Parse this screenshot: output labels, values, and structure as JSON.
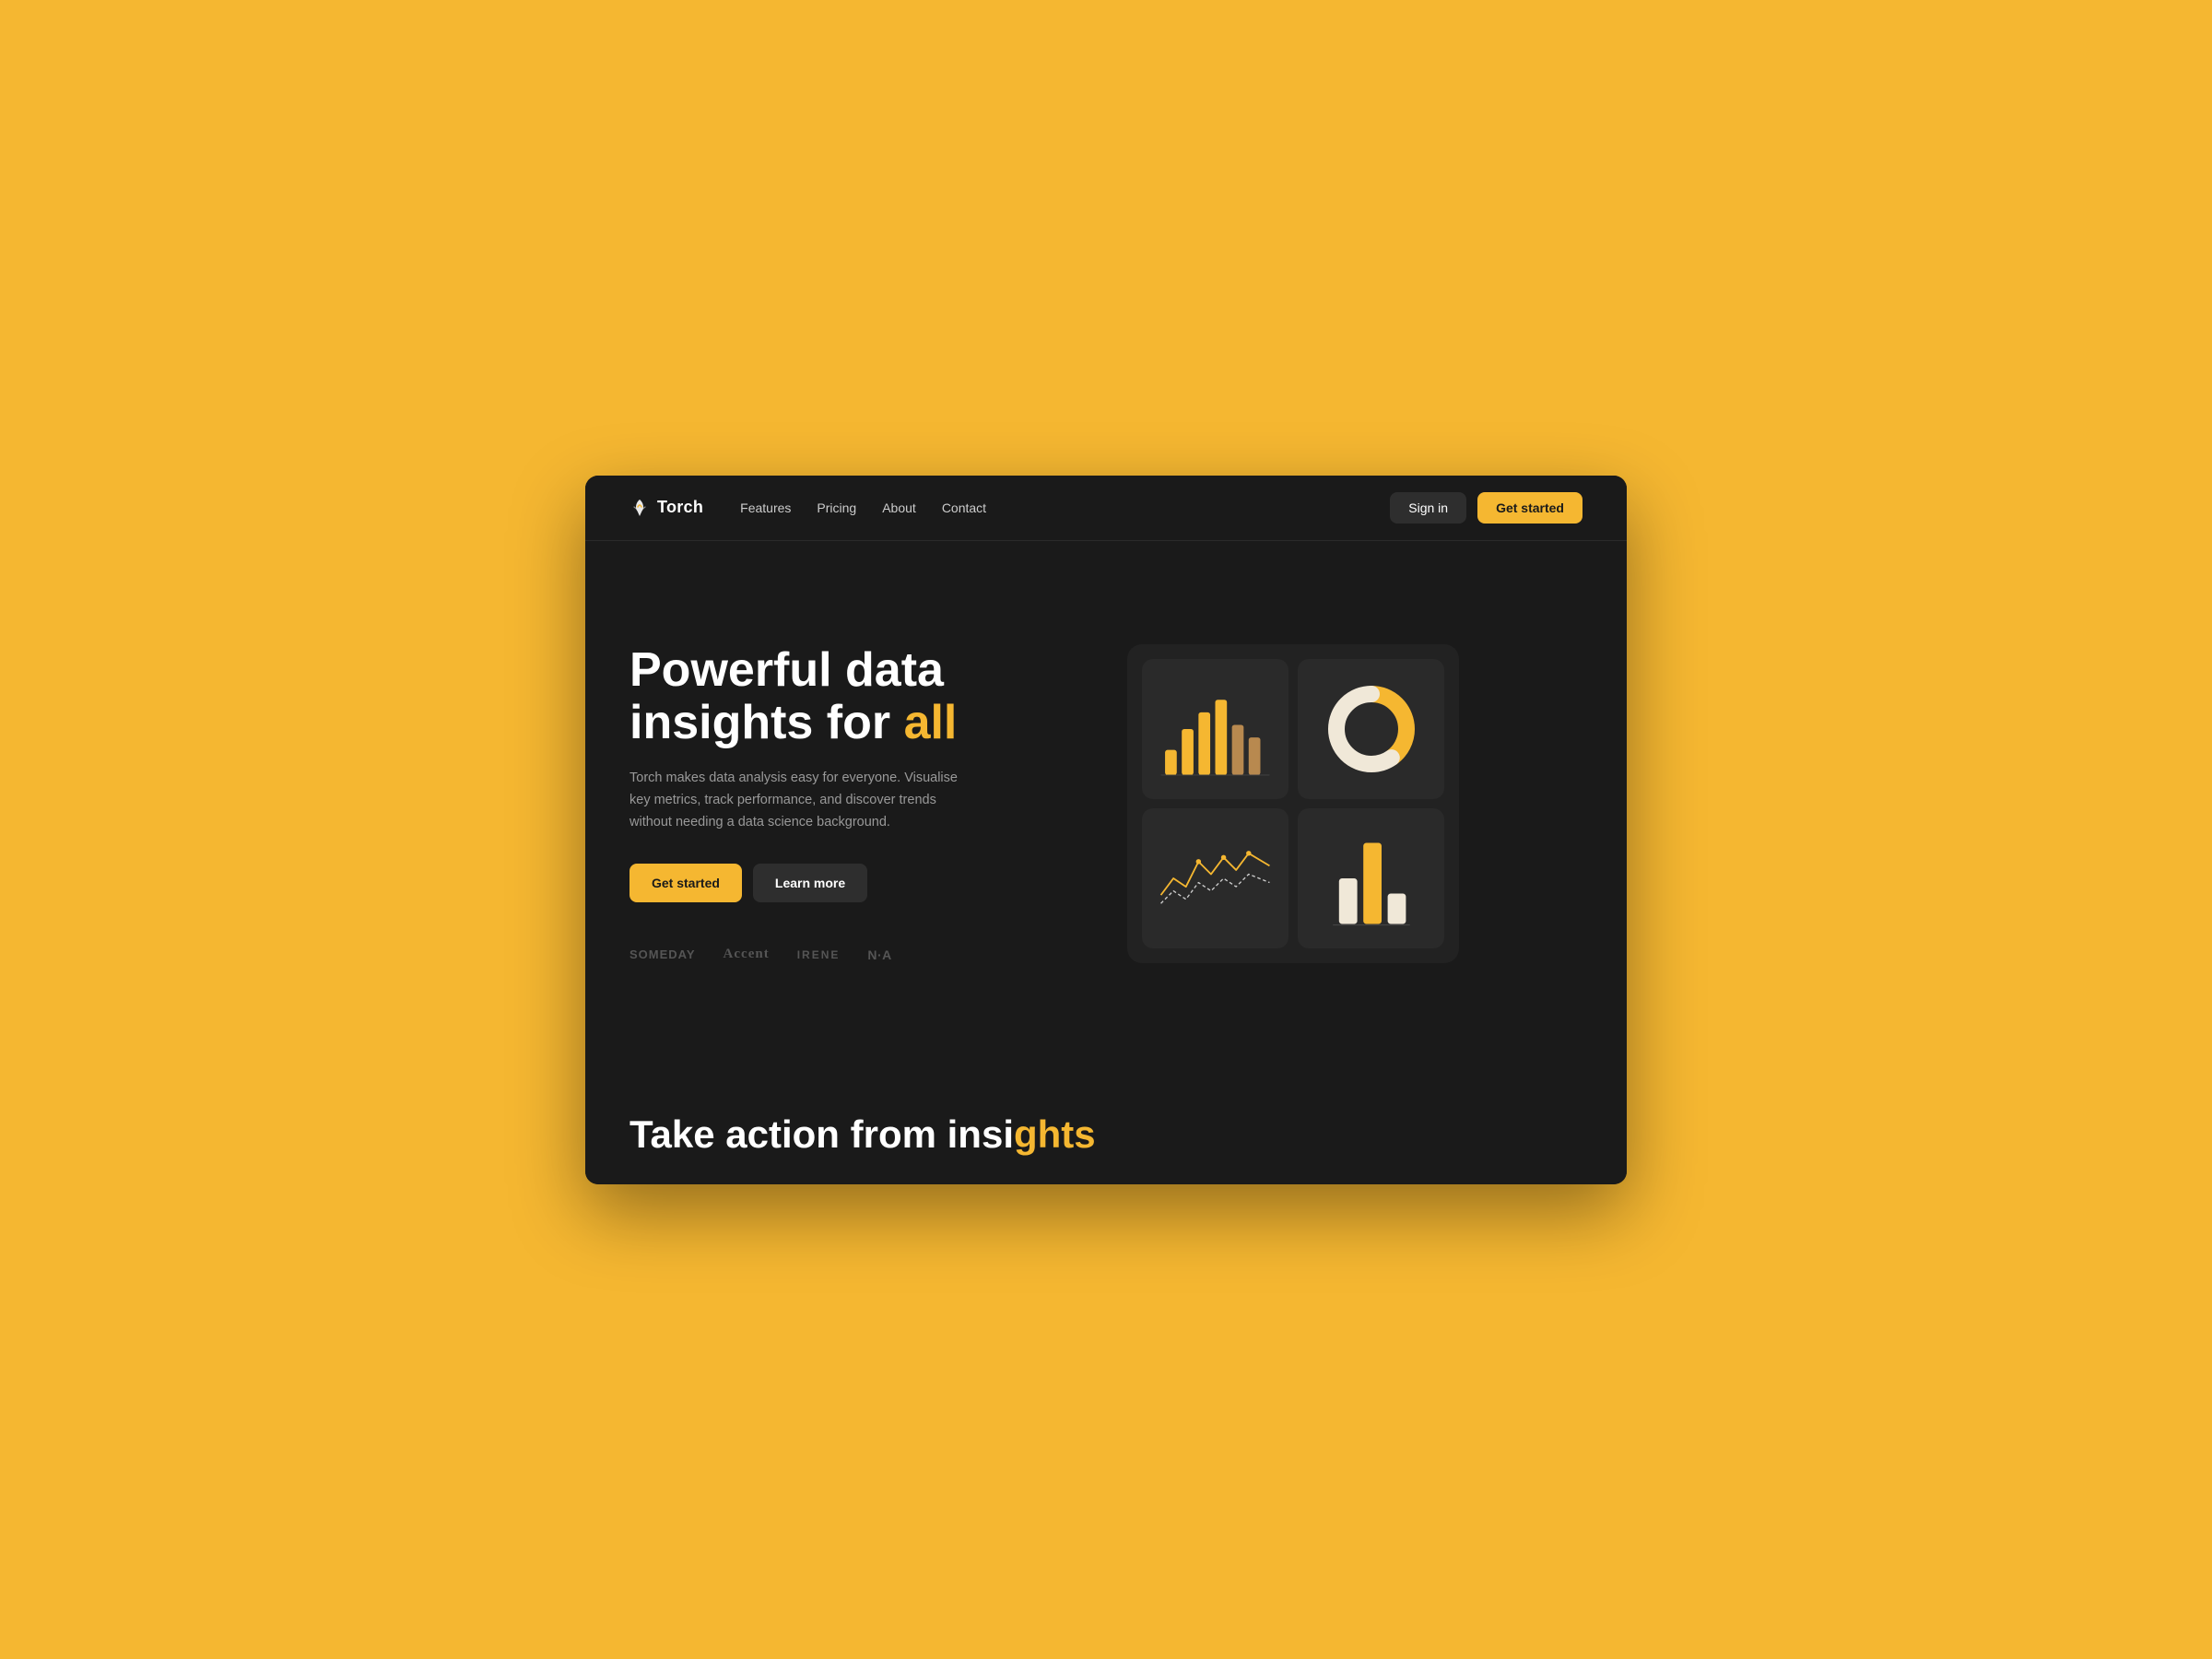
{
  "page": {
    "bg_color": "#F5B731",
    "accent_color": "#F5B731"
  },
  "navbar": {
    "logo_text": "Torch",
    "nav_links": [
      {
        "label": "Features",
        "id": "features"
      },
      {
        "label": "Pricing",
        "id": "pricing"
      },
      {
        "label": "About",
        "id": "about"
      },
      {
        "label": "Contact",
        "id": "contact"
      }
    ],
    "signin_label": "Sign in",
    "getstarted_label": "Get started"
  },
  "hero": {
    "title_line1": "Powerful data",
    "title_line2_normal": "insights ",
    "title_line2_pre": "for ",
    "title_line2_highlight": "all",
    "description": "Torch makes data analysis easy for everyone. Visualise key metrics, track performance, and discover trends without needing a data science background.",
    "cta_primary": "Get started",
    "cta_secondary": "Learn more",
    "brands": [
      {
        "label": "SOMEDAY",
        "style": "default"
      },
      {
        "label": "Accent",
        "style": "accent"
      },
      {
        "label": "IRENE",
        "style": "irene"
      },
      {
        "label": "n·a",
        "style": "nra"
      }
    ]
  },
  "bottom": {
    "title_normal": "Take action from insi",
    "title_highlight": "ghts"
  }
}
